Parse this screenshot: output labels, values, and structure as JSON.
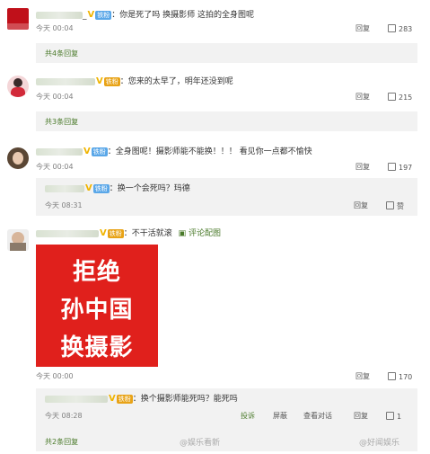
{
  "comments": [
    {
      "text": "：你是死了吗  换摄影师  这拍的全身图呢",
      "badge": "铁粉",
      "time": "今天 00:04",
      "reply_label": "回复",
      "likes": "283",
      "more": "共4条回复"
    },
    {
      "text": "：您来的太早了，明年还没到呢",
      "badge": "铁粉",
      "time": "今天 00:04",
      "reply_label": "回复",
      "likes": "215",
      "more": "共3条回复"
    },
    {
      "text": "：全身图呢！摄影师能不能换！！！ 看见你一点都不愉快",
      "badge": "铁粉",
      "time": "今天 00:04",
      "reply_label": "回复",
      "likes": "197",
      "reply": {
        "badge": "铁粉",
        "text": "：换一个会死吗？玛德",
        "time": "今天 08:31",
        "reply_label": "回复",
        "likes": "赞"
      }
    },
    {
      "text": "：不干活就滚",
      "badge": "铁粉",
      "link": "评论配图",
      "poster": [
        "拒绝",
        "孙中国",
        "换摄影"
      ],
      "time": "今天 00:00",
      "reply_label": "回复",
      "likes": "170",
      "reply": {
        "badge": "铁粉",
        "text": "：换个摄影师能死吗？能死吗",
        "time": "今天 08:28",
        "actions": [
          "投诉",
          "屏蔽",
          "查看对话",
          "回复"
        ],
        "likes": "1"
      },
      "more": "共2条回复"
    }
  ],
  "watermarks": [
    "@娱乐看新",
    "@好闻娱乐"
  ]
}
